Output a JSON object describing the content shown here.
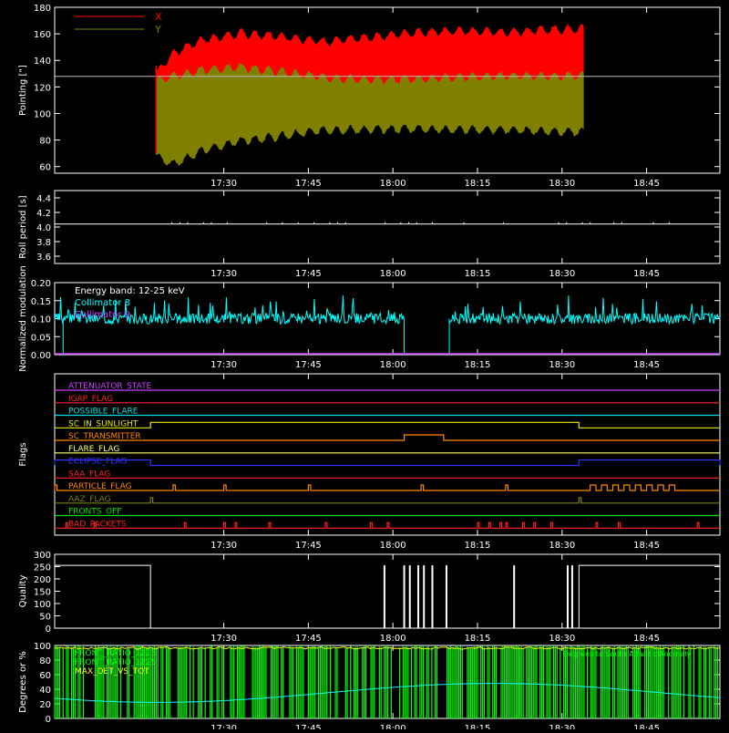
{
  "colors": {
    "background": "#000000",
    "axis": "#ffffff",
    "x_series": "#ff0000",
    "y_series": "#808000",
    "roll": "#ffffff",
    "collimator": "#00ffff",
    "quality": "#ffffff",
    "angle_fill": "#00ff00",
    "angle_line": "#00ffff",
    "ratio_line": "#ffff00"
  },
  "time_axis": {
    "tick_labels": [
      "17:30",
      "17:45",
      "18:00",
      "18:15",
      "18:30",
      "18:45"
    ],
    "tick_minutes": [
      1050,
      1065,
      1080,
      1095,
      1110,
      1125
    ],
    "range_minutes": [
      1020,
      1138
    ]
  },
  "chart_data": [
    {
      "type": "area",
      "name": "pointing",
      "ylabel": "Pointing [\"]",
      "ylim": [
        55,
        180
      ],
      "yticks": [
        60,
        80,
        100,
        120,
        140,
        160,
        180
      ],
      "reference_line": 128,
      "legend": [
        {
          "label": "X",
          "color": "#ff0000"
        },
        {
          "label": "Y",
          "color": "#808000"
        }
      ],
      "data_start_minute": 1038,
      "data_end_minute": 1114,
      "series": [
        {
          "name": "X",
          "x": [
            1038,
            1041,
            1046,
            1053,
            1060,
            1068,
            1076,
            1084,
            1092,
            1100,
            1108,
            1114
          ],
          "upper": [
            130,
            145,
            155,
            160,
            158,
            154,
            157,
            161,
            162,
            161,
            163,
            164
          ],
          "lower": [
            75,
            90,
            105,
            110,
            108,
            104,
            102,
            104,
            107,
            109,
            110,
            112
          ]
        },
        {
          "name": "Y",
          "x": [
            1038,
            1041,
            1046,
            1053,
            1060,
            1068,
            1076,
            1084,
            1092,
            1100,
            1108,
            1114
          ],
          "upper": [
            124,
            128,
            132,
            135,
            131,
            127,
            125,
            126,
            127,
            128,
            128,
            128
          ],
          "lower": [
            68,
            62,
            72,
            80,
            83,
            88,
            88,
            89,
            88,
            88,
            87,
            86
          ]
        }
      ]
    },
    {
      "type": "line",
      "name": "roll",
      "ylabel": "Roll period [s]",
      "ylim": [
        3.5,
        4.5
      ],
      "yticks": [
        3.6,
        3.8,
        4.0,
        4.2,
        4.4
      ],
      "value": 4.04
    },
    {
      "type": "line",
      "name": "modulation",
      "ylabel": "Normalized modulation",
      "ylim": [
        0,
        0.2
      ],
      "yticks": [
        0.0,
        0.05,
        0.1,
        0.15,
        0.2
      ],
      "annotations": [
        "Energy band: 12-25 keV",
        "Collimator 8",
        "Collimator 9"
      ],
      "segments": [
        {
          "name": "Collimator 8",
          "start": 1020,
          "end": 1082,
          "mean": 0.1
        },
        {
          "name": "Collimator 8",
          "start": 1090,
          "end": 1138,
          "mean": 0.1
        }
      ],
      "gap": [
        1082,
        1090
      ]
    },
    {
      "type": "line",
      "name": "flags",
      "ylabel": "Flags",
      "rows": [
        {
          "label": "ATTENUATOR_STATE",
          "color": "#cc44ff",
          "pulses": []
        },
        {
          "label": "IGAP_FLAG",
          "color": "#ff2222",
          "pulses": []
        },
        {
          "label": "POSSIBLE_FLARE",
          "color": "#00e0e0",
          "pulses": []
        },
        {
          "label": "SC_IN_SUNLIGHT",
          "color": "#e8e800",
          "pulses": [
            [
              1037,
              1113
            ]
          ]
        },
        {
          "label": "SC_TRANSMITTER",
          "color": "#ff8800",
          "pulses": [
            [
              1082,
              1089
            ]
          ]
        },
        {
          "label": "FLARE_FLAG",
          "color": "#ffff66",
          "pulses": []
        },
        {
          "label": "ECLIPSE_FLAG",
          "color": "#3333ff",
          "pulses": [
            [
              1020,
              1037
            ],
            [
              1113,
              1138
            ]
          ]
        },
        {
          "label": "SAA_FLAG",
          "color": "#ff2222",
          "pulses": []
        },
        {
          "label": "PARTICLE_FLAG",
          "color": "#ff8800",
          "pulses": [
            [
              1020,
              1020.4
            ],
            [
              1041,
              1041.4
            ],
            [
              1050,
              1050.4
            ],
            [
              1065,
              1065.4
            ],
            [
              1085,
              1085.4
            ],
            [
              1100,
              1100.4
            ],
            [
              1115,
              1116
            ],
            [
              1117,
              1118
            ],
            [
              1119,
              1120
            ],
            [
              1121,
              1122
            ],
            [
              1123,
              1124
            ],
            [
              1125,
              1126
            ],
            [
              1127,
              1128
            ],
            [
              1129,
              1130
            ]
          ]
        },
        {
          "label": "AAZ_FLAG",
          "color": "#808000",
          "pulses": [
            [
              1037,
              1037.4
            ],
            [
              1113,
              1113.4
            ]
          ]
        },
        {
          "label": "FRONTS_OFF",
          "color": "#00e000",
          "pulses": []
        },
        {
          "label": "BAD_PACKETS",
          "color": "#ff2222",
          "pulses": [
            [
              1022,
              1022.3
            ],
            [
              1027,
              1027.3
            ],
            [
              1043,
              1043.3
            ],
            [
              1050,
              1050.3
            ],
            [
              1052,
              1052.3
            ],
            [
              1058,
              1058.3
            ],
            [
              1068,
              1068.3
            ],
            [
              1076,
              1076.3
            ],
            [
              1079,
              1079.3
            ],
            [
              1095,
              1095.3
            ],
            [
              1097,
              1097.3
            ],
            [
              1099,
              1099.3
            ],
            [
              1100,
              1100.3
            ],
            [
              1103,
              1103.3
            ],
            [
              1105,
              1105.3
            ],
            [
              1108,
              1108.3
            ],
            [
              1116,
              1116.3
            ],
            [
              1120,
              1120.3
            ],
            [
              1134,
              1134.3
            ]
          ]
        }
      ]
    },
    {
      "type": "line",
      "name": "quality",
      "ylabel": "Quality",
      "ylim": [
        0,
        300
      ],
      "yticks": [
        0,
        50,
        100,
        150,
        200,
        250,
        300
      ],
      "high": 255,
      "low": 0,
      "drops": [
        [
          1037,
          1113
        ]
      ],
      "spikes": [
        1078.5,
        1082,
        1083,
        1084.5,
        1085.5,
        1087,
        1089.5,
        1101.5,
        1111,
        1111.8
      ]
    },
    {
      "type": "area",
      "name": "angles",
      "ylabel": "Degrees or %",
      "ylim": [
        0,
        100
      ],
      "yticks": [
        0,
        20,
        40,
        60,
        80,
        100
      ],
      "legend": [
        {
          "label": "FRONT_RATIO_1223",
          "color": "#00ff00"
        },
        {
          "label": "FRONT_RATIO_1225",
          "color": "#00ff00"
        },
        {
          "label": "MAX_DET_VS_TOT",
          "color": "#ffff00"
        }
      ],
      "annotation": "Degrees to South Atlantic Anomaly",
      "annotation_color": "#00ff00"
    }
  ]
}
